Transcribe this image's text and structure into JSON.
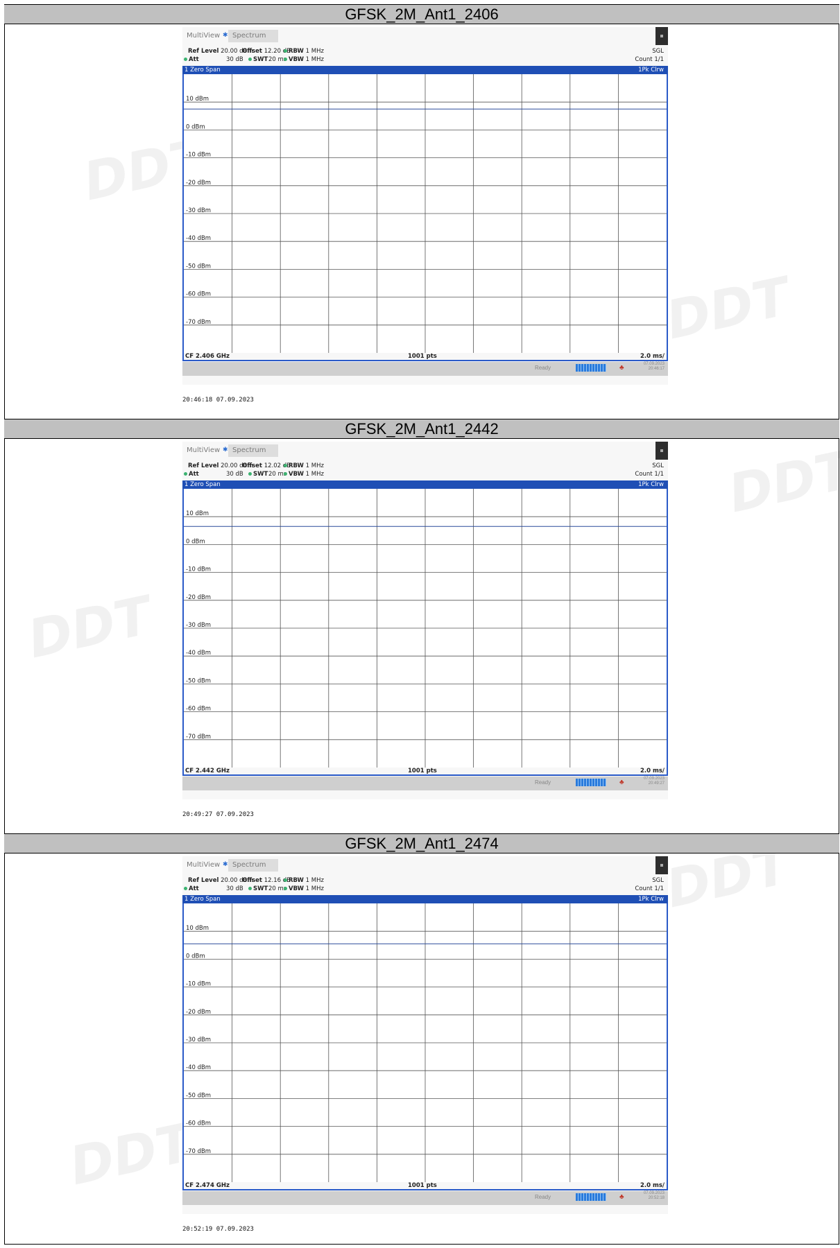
{
  "watermark": "DDT",
  "sections": [
    {
      "title": "GFSK_2M_Ant1_2406",
      "tabs": {
        "multiview": "MultiView",
        "spectrum": "Spectrum"
      },
      "info": {
        "ref_level_label": "Ref Level",
        "ref_level": "20.00 dBm",
        "offset_label": "Offset",
        "offset": "12.20 dB",
        "rbw_label": "RBW",
        "rbw": "1 MHz",
        "att_label": "Att",
        "att": "30 dB",
        "swt_label": "SWT",
        "swt": "20 ms",
        "vbw_label": "VBW",
        "vbw": "1 MHz",
        "sgl": "SGL",
        "count": "Count 1/1"
      },
      "trace_bar": {
        "left": "1 Zero Span",
        "right": "1Pk Clrw"
      },
      "footer": {
        "cf": "CF 2.406 GHz",
        "pts": "1001 pts",
        "div": "2.0 ms/"
      },
      "status": {
        "ready": "Ready",
        "date": "07.09.2023",
        "time": "20:46:17"
      },
      "timestamp": "20:46:18  07.09.2023"
    },
    {
      "title": "GFSK_2M_Ant1_2442",
      "tabs": {
        "multiview": "MultiView",
        "spectrum": "Spectrum"
      },
      "info": {
        "ref_level_label": "Ref Level",
        "ref_level": "20.00 dBm",
        "offset_label": "Offset",
        "offset": "12.02 dB",
        "rbw_label": "RBW",
        "rbw": "1 MHz",
        "att_label": "Att",
        "att": "30 dB",
        "swt_label": "SWT",
        "swt": "20 ms",
        "vbw_label": "VBW",
        "vbw": "1 MHz",
        "sgl": "SGL",
        "count": "Count 1/1"
      },
      "trace_bar": {
        "left": "1 Zero Span",
        "right": "1Pk Clrw"
      },
      "footer": {
        "cf": "CF 2.442 GHz",
        "pts": "1001 pts",
        "div": "2.0 ms/"
      },
      "status": {
        "ready": "Ready",
        "date": "07.09.2023",
        "time": "20:49:27"
      },
      "timestamp": "20:49:27  07.09.2023"
    },
    {
      "title": "GFSK_2M_Ant1_2474",
      "tabs": {
        "multiview": "MultiView",
        "spectrum": "Spectrum"
      },
      "info": {
        "ref_level_label": "Ref Level",
        "ref_level": "20.00 dBm",
        "offset_label": "Offset",
        "offset": "12.16 dB",
        "rbw_label": "RBW",
        "rbw": "1 MHz",
        "att_label": "Att",
        "att": "30 dB",
        "swt_label": "SWT",
        "swt": "20 ms",
        "vbw_label": "VBW",
        "vbw": "1 MHz",
        "sgl": "SGL",
        "count": "Count 1/1"
      },
      "trace_bar": {
        "left": "1 Zero Span",
        "right": "1Pk Clrw"
      },
      "footer": {
        "cf": "CF 2.474 GHz",
        "pts": "1001 pts",
        "div": "2.0 ms/"
      },
      "status": {
        "ready": "Ready",
        "date": "07.09.2023",
        "time": "20:52:18"
      },
      "timestamp": "20:52:19  07.09.2023"
    }
  ],
  "chart_data": [
    {
      "type": "line",
      "title": "GFSK_2M_Ant1_2406",
      "x": [
        0,
        20
      ],
      "y_ticks": [
        10,
        0,
        -10,
        -20,
        -30,
        -40,
        -50,
        -60,
        -70
      ],
      "tick_labels": [
        "10 dBm",
        "0 dBm",
        "-10 dBm",
        "-20 dBm",
        "-30 dBm",
        "-40 dBm",
        "-50 dBm",
        "-60 dBm",
        "-70 dBm"
      ],
      "ylim": [
        -80,
        20
      ],
      "xlim": [
        0,
        20
      ],
      "x_divisions": 10,
      "grid": true,
      "trace_color": "#2a4a9a",
      "series": [
        {
          "values": [
            7.5,
            7.5
          ]
        }
      ]
    },
    {
      "type": "line",
      "title": "GFSK_2M_Ant1_2442",
      "x": [
        0,
        20
      ],
      "y_ticks": [
        10,
        0,
        -10,
        -20,
        -30,
        -40,
        -50,
        -60,
        -70
      ],
      "tick_labels": [
        "10 dBm",
        "0 dBm",
        "-10 dBm",
        "-20 dBm",
        "-30 dBm",
        "-40 dBm",
        "-50 dBm",
        "-60 dBm",
        "-70 dBm"
      ],
      "ylim": [
        -80,
        20
      ],
      "xlim": [
        0,
        20
      ],
      "x_divisions": 10,
      "grid": true,
      "trace_color": "#2a4a9a",
      "series": [
        {
          "values": [
            6.5,
            6.5
          ]
        }
      ]
    },
    {
      "type": "line",
      "title": "GFSK_2M_Ant1_2474",
      "x": [
        0,
        20
      ],
      "y_ticks": [
        10,
        0,
        -10,
        -20,
        -30,
        -40,
        -50,
        -60,
        -70
      ],
      "tick_labels": [
        "10 dBm",
        "0 dBm",
        "-10 dBm",
        "-20 dBm",
        "-30 dBm",
        "-40 dBm",
        "-50 dBm",
        "-60 dBm",
        "-70 dBm"
      ],
      "ylim": [
        -80,
        20
      ],
      "xlim": [
        0,
        20
      ],
      "x_divisions": 10,
      "grid": true,
      "trace_color": "#2a4a9a",
      "series": [
        {
          "values": [
            5.5,
            5.5
          ]
        }
      ]
    }
  ]
}
